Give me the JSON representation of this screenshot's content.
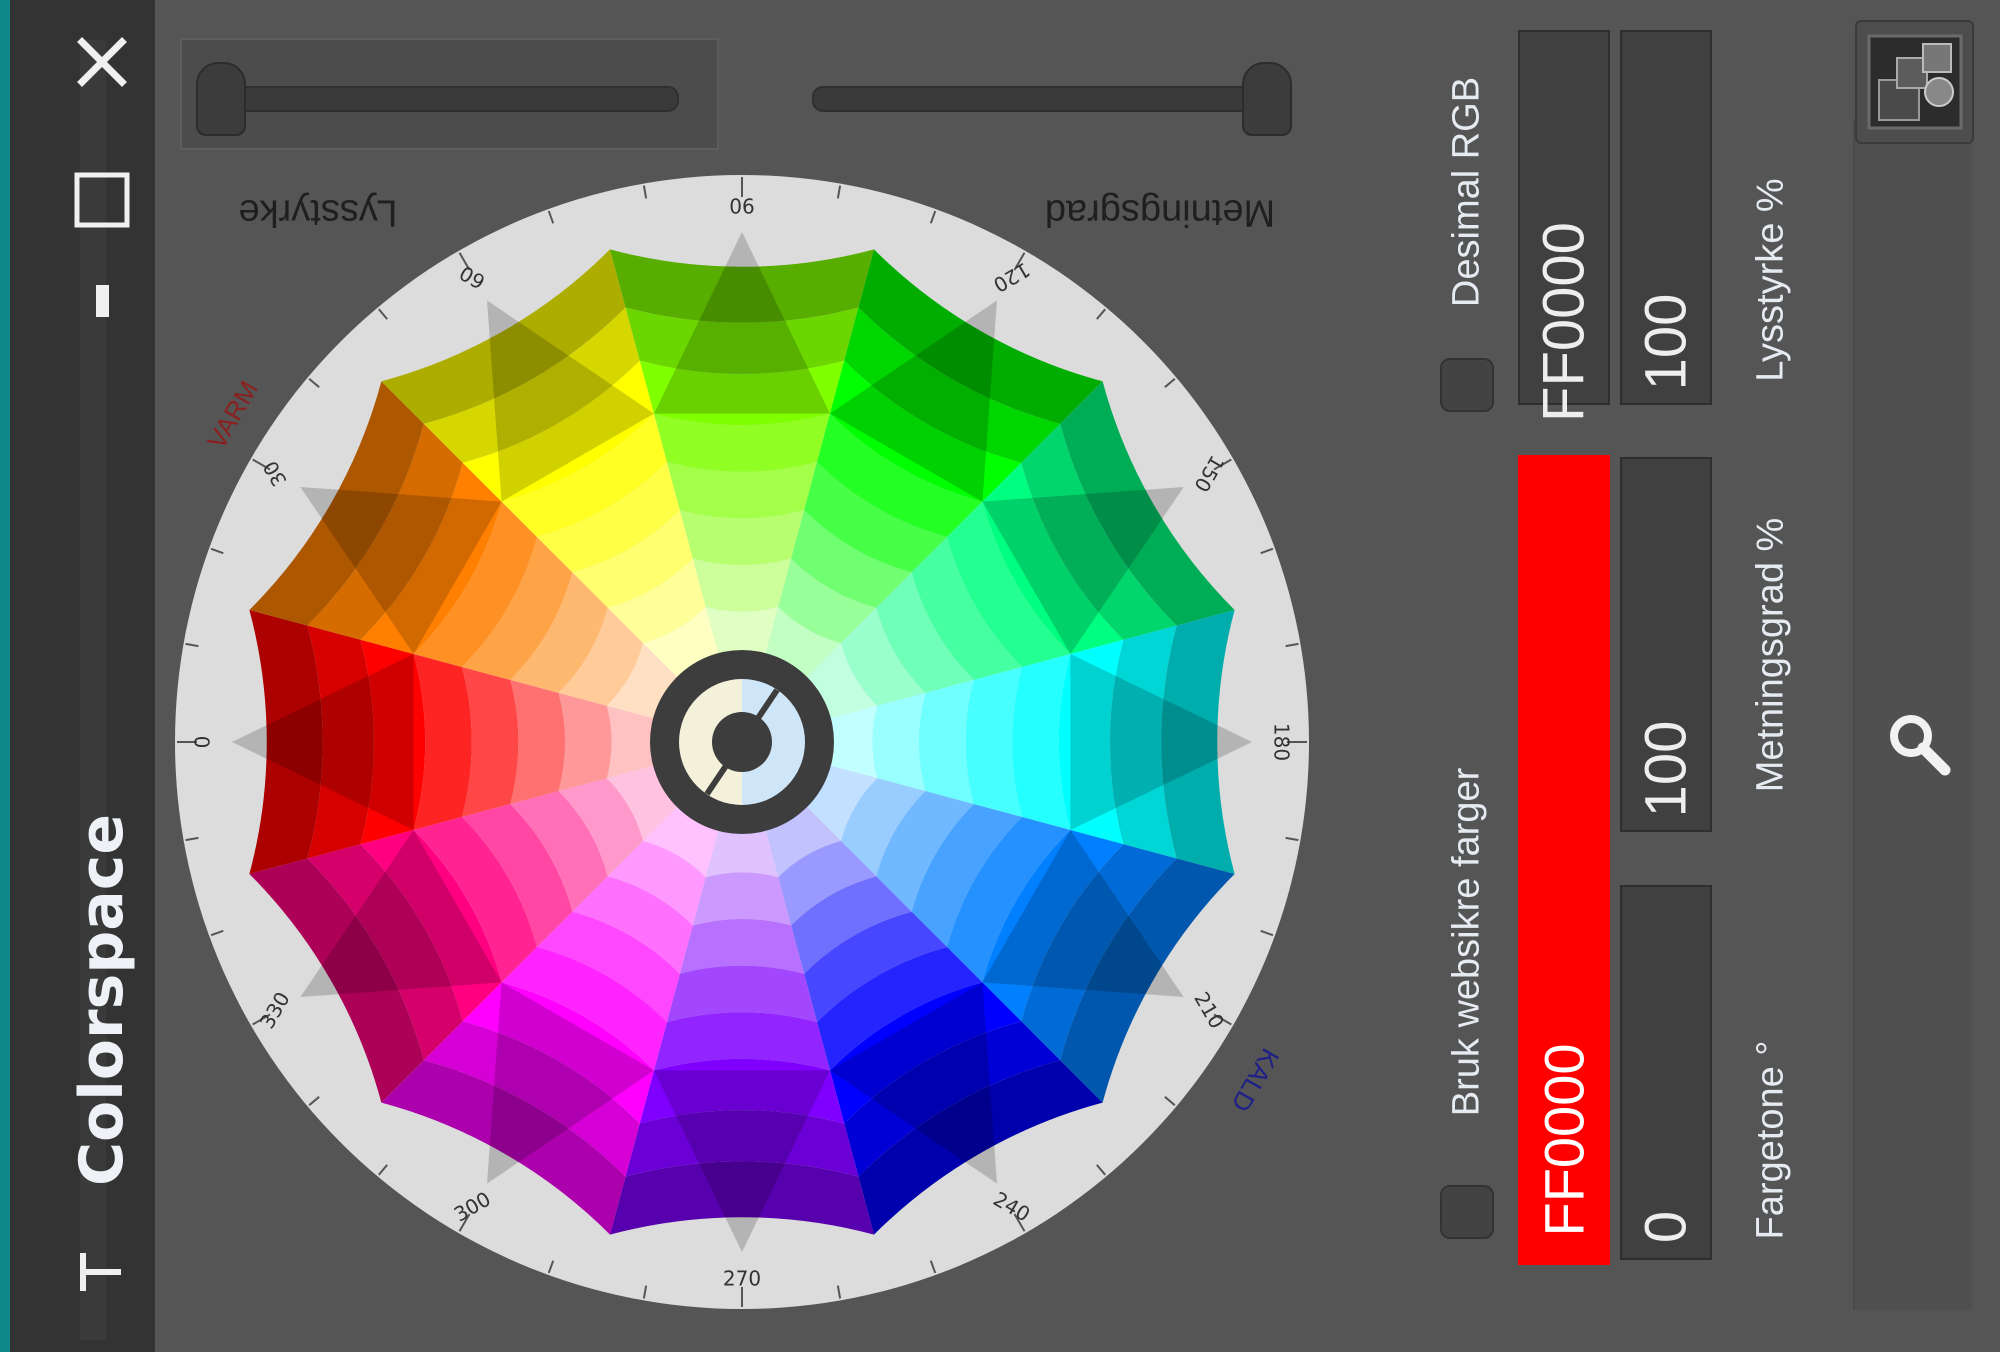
{
  "window": {
    "title": "Colorspace",
    "close_icon": "close-icon",
    "maximize_icon": "maximize-icon",
    "minimize_icon": "minimize-icon",
    "pin_icon": "pin-icon"
  },
  "sliders": {
    "lightness_label": "Lysstyrke",
    "saturation_label": "Metningsgrad"
  },
  "wheel": {
    "degree_labels": [
      "0",
      "30",
      "60",
      "90",
      "120",
      "150",
      "180",
      "210",
      "240",
      "270",
      "300",
      "330"
    ],
    "warm_label": "VARM",
    "cold_label": "KALD"
  },
  "controls": {
    "websafe_label": "Bruk websikre farger",
    "decimal_rgb_label": "Desimal RGB",
    "hex_value": "FF0000",
    "hex_field_value": "FF0000",
    "hue_value": "0",
    "saturation_value": "100",
    "lightness_value": "100",
    "hue_label": "Fargetone °",
    "saturation_label": "Metningsgrad %",
    "lightness_label": "Lysstyrke %",
    "current_color": "#FF0000"
  },
  "tools": {
    "eyedropper_icon": "color-picker-icon",
    "search_icon": "search-icon"
  }
}
